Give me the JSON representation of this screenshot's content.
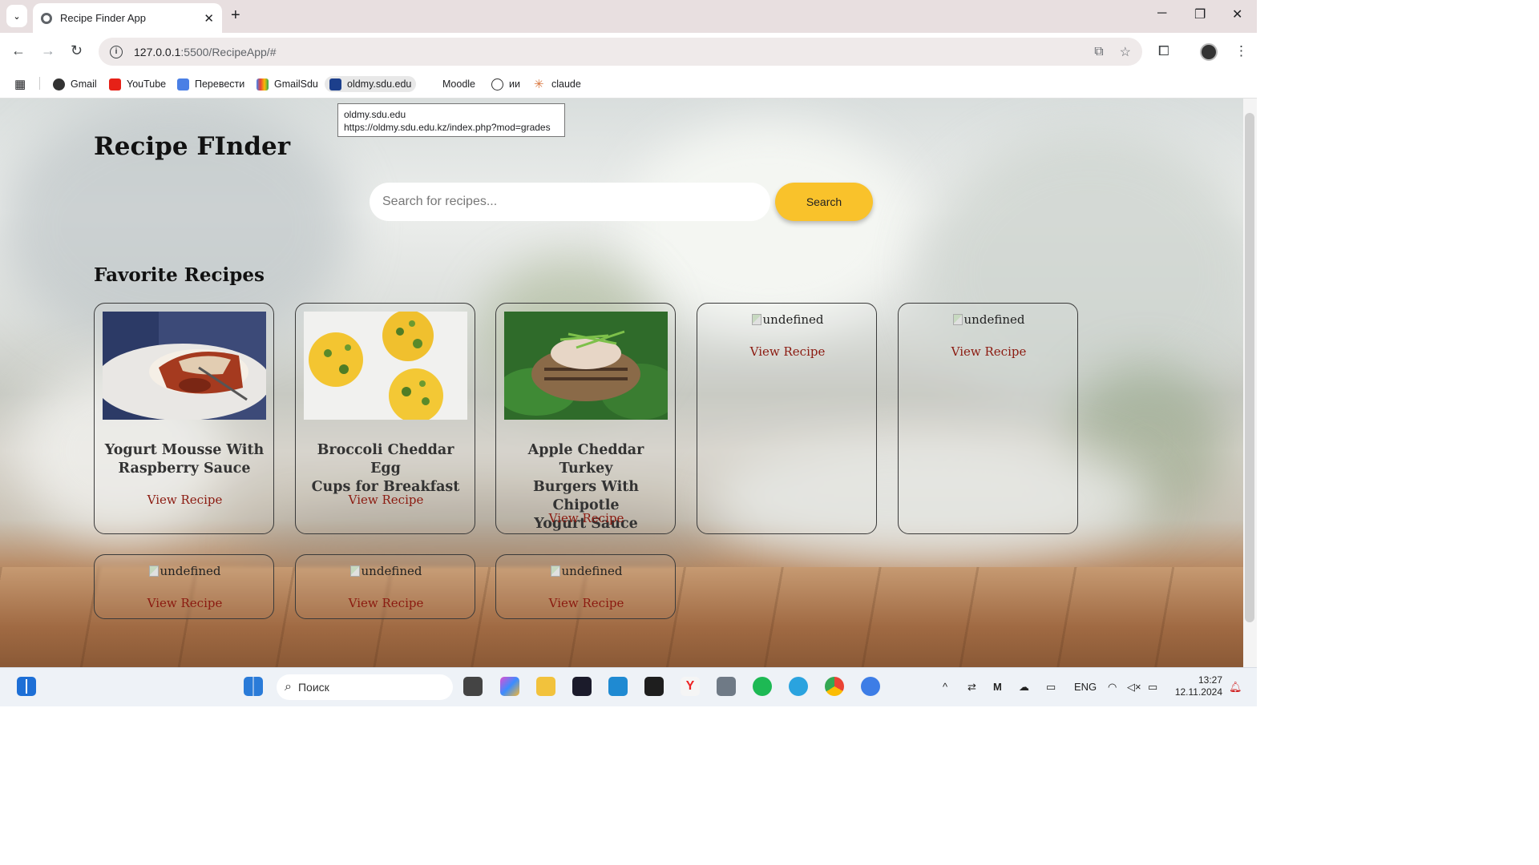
{
  "browser": {
    "tab_title": "Recipe Finder App",
    "url_host": "127.0.0.1",
    "url_rest": ":5500/RecipeApp/#",
    "bookmarks": [
      "Gmail",
      "YouTube",
      "Перевести",
      "GmailSdu",
      "oldmy.sdu.edu",
      "Moodle",
      "ии",
      "claude"
    ]
  },
  "tooltip": {
    "line1": "oldmy.sdu.edu",
    "line2": "https://oldmy.sdu.edu.kz/index.php?mod=grades"
  },
  "app": {
    "title": "Recipe FInder",
    "search_placeholder": "Search for recipes...",
    "search_button": "Search",
    "favorites_title": "Favorite Recipes",
    "view_label": "View Recipe"
  },
  "cards": [
    {
      "title_lines": [
        "Yogurt Mousse With",
        "Raspberry Sauce"
      ],
      "image": "dessert"
    },
    {
      "title_lines": [
        "Broccoli Cheddar Egg",
        "Cups for Breakfast"
      ],
      "image": "eggcups"
    },
    {
      "title_lines": [
        "Apple Cheddar Turkey",
        "Burgers With Chipotle",
        "Yogurt Sauce"
      ],
      "image": "burger"
    },
    {
      "broken_alt": "undefined"
    },
    {
      "broken_alt": "undefined"
    },
    {
      "broken_alt": "undefined"
    },
    {
      "broken_alt": "undefined"
    },
    {
      "broken_alt": "undefined"
    }
  ],
  "taskbar": {
    "search_placeholder": "Поиск",
    "lang": "ENG",
    "time": "13:27",
    "date": "12.11.2024"
  }
}
